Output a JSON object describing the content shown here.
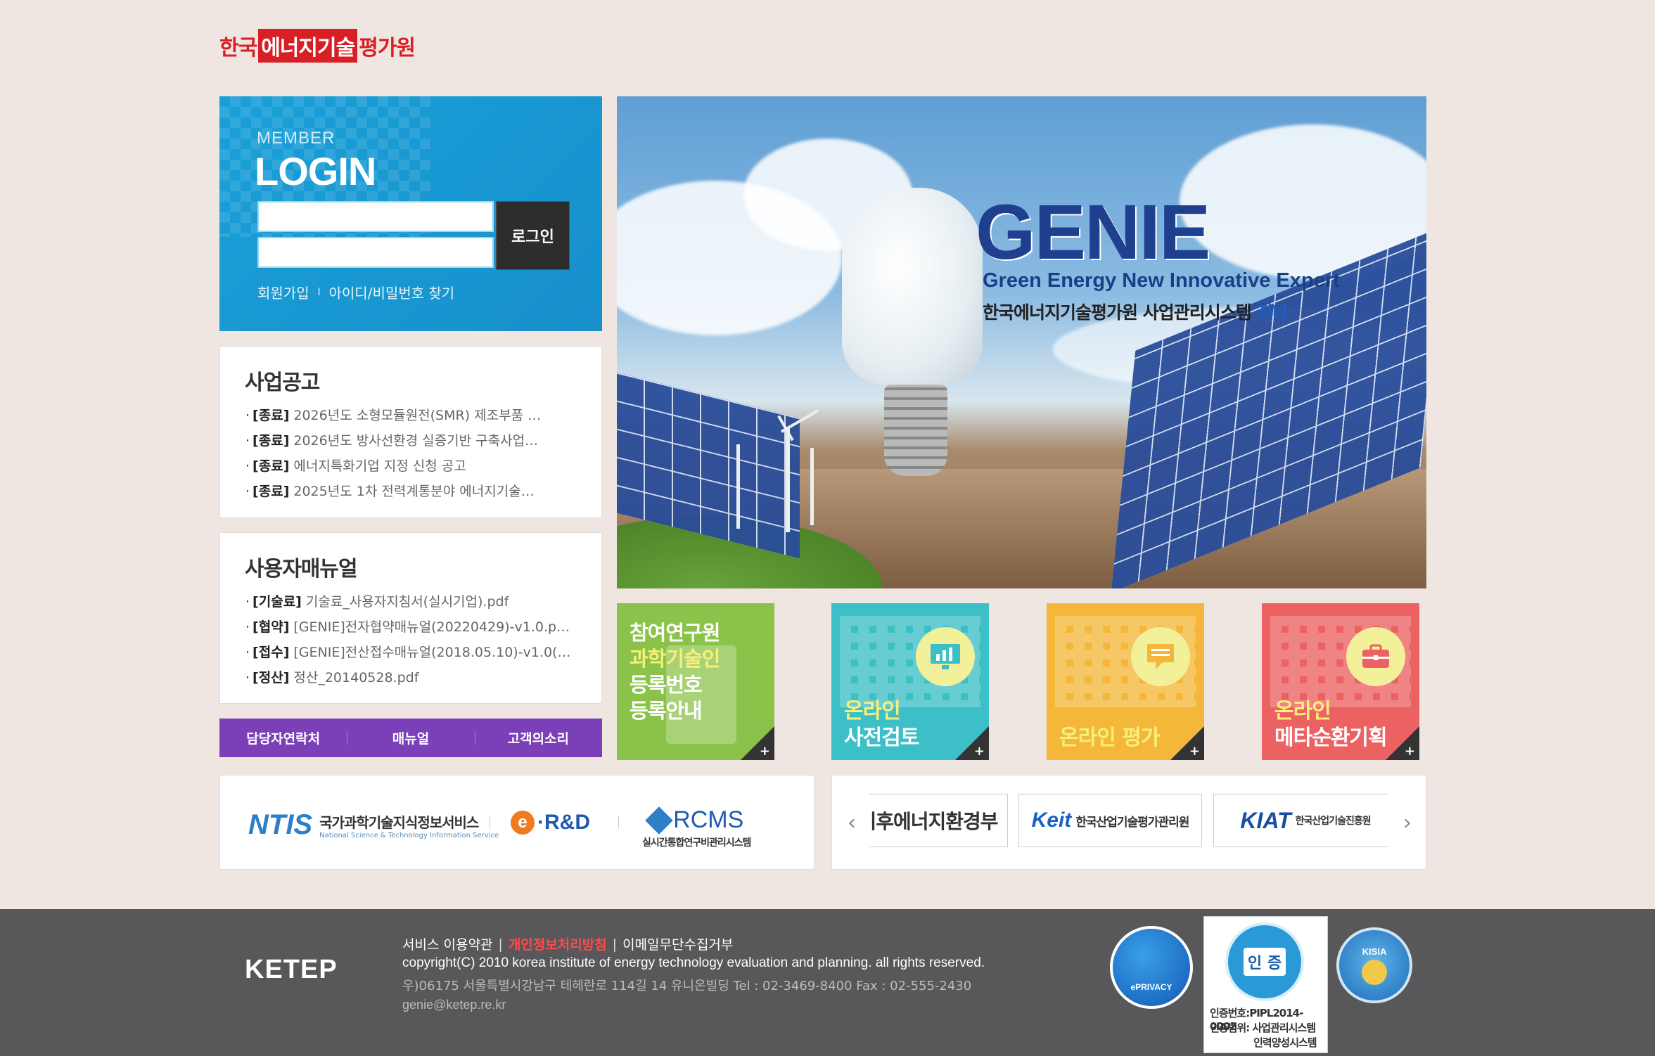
{
  "logo": {
    "part1": "한국",
    "part2": "에너지기술",
    "part3": "평가원"
  },
  "login": {
    "member_label": "MEMBER",
    "title": "LOGIN",
    "id_value": "",
    "pw_value": "",
    "button_label": "로그인",
    "link_join": "회원가입",
    "link_sep": "l",
    "link_find": "아이디/비밀번호 찾기"
  },
  "notice": {
    "title": "사업공고",
    "items": [
      {
        "tag": "[종료]",
        "text": "2026년도 소형모듈원전(SMR) 제조부품 …"
      },
      {
        "tag": "[종료]",
        "text": "2026년도 방사선환경 실증기반 구축사업…"
      },
      {
        "tag": "[종료]",
        "text": "에너지특화기업 지정 신청 공고"
      },
      {
        "tag": "[종료]",
        "text": "2025년도 1차 전력계통분야 에너지기술…"
      }
    ]
  },
  "manual": {
    "title": "사용자매뉴얼",
    "items": [
      {
        "tag": "[기술료]",
        "text": "기술료_사용자지침서(실시기업).pdf"
      },
      {
        "tag": "[협약]",
        "text": "[GENIE]전자협약매뉴얼(20220429)-v1.0.p…"
      },
      {
        "tag": "[접수]",
        "text": "[GENIE]전산접수매뉴얼(2018.05.10)-v1.0(…"
      },
      {
        "tag": "[정산]",
        "text": "정산_20140528.pdf"
      }
    ]
  },
  "quicklinks": [
    "담당자연락처",
    "매뉴얼",
    "고객의소리"
  ],
  "hero": {
    "title": "GENIE",
    "subtitle": "Green Energy New Innovative Expert",
    "tagline_main": "한국에너지기술평가원 사업관리시스템",
    "tagline_blue": "지니"
  },
  "tiles": [
    {
      "lines": [
        "참여연구원",
        "과학기술인",
        "등록번호",
        "등록안내"
      ],
      "plus": "+"
    },
    {
      "lines": [
        "온라인",
        "사전검토"
      ],
      "plus": "+"
    },
    {
      "lines": [
        "온라인 평가"
      ],
      "plus": "+"
    },
    {
      "lines": [
        "온라인",
        "메타순환기획"
      ],
      "plus": "+"
    }
  ],
  "partners": {
    "ntis_mark": "NTIS",
    "ntis_kor": "국가과학기술지식정보서비스",
    "ntis_eng": "National Science & Technology Information Service",
    "erd_e": "e",
    "erd_text": "·R&D",
    "rcms_word": "RCMS",
    "rcms_sub": "실시간통합연구비관리시스템"
  },
  "banners": {
    "b1": "기후에너지환경부",
    "b2_mark": "Keit",
    "b2_text": "한국산업기술평가관리원",
    "b3_mark": "KIAT",
    "b3_text": "한국산업기술진흥원",
    "prev": "‹",
    "next": "›"
  },
  "footer": {
    "logo": "KETEP",
    "link_terms": "서비스 이용약관",
    "link_privacy": "개인정보처리방침",
    "link_email": "이메일무단수집거부",
    "copyright": "copyright(C) 2010 korea institute of energy technology evaluation and planning. all rights reserved.",
    "address": "우)06175 서울특별시강남구 테헤란로 114길 14 유니온빌딩 Tel : 02-3469-8400 Fax : 02-555-2430",
    "email": "genie@ketep.re.kr",
    "eprivacy": "ePRIVACY",
    "pipl_seal": "인 증",
    "pipl_no": "인증번호:PIPL2014-0002",
    "pipl_scope": "인증범위: 사업관리시스템",
    "pipl_scope2": "인력양성시스템",
    "kisia": "KISIA"
  }
}
